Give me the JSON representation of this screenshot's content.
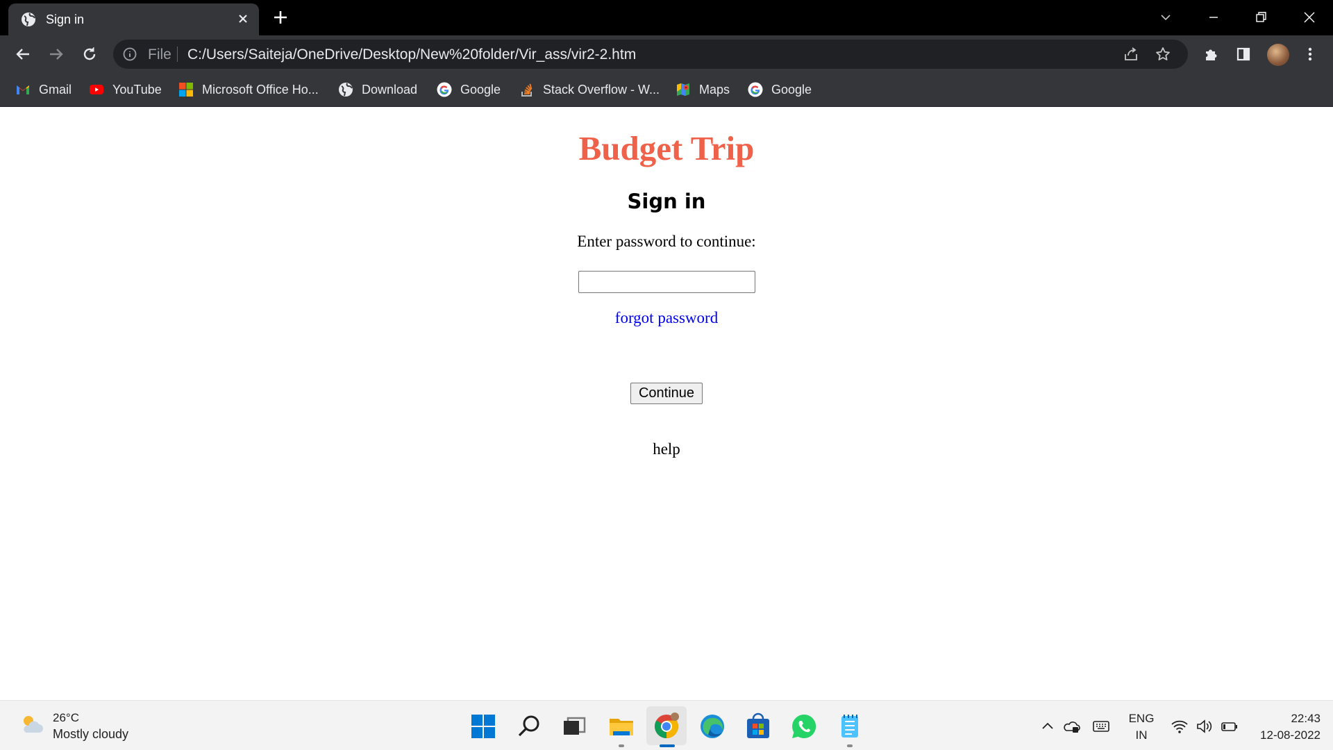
{
  "browser": {
    "tab": {
      "title": "Sign in"
    },
    "omnibox": {
      "scheme_label": "File",
      "url": "C:/Users/Saiteja/OneDrive/Desktop/New%20folder/Vir_ass/vir2-2.htm"
    },
    "bookmarks": [
      {
        "label": "Gmail",
        "icon": "gmail-icon"
      },
      {
        "label": "YouTube",
        "icon": "youtube-icon"
      },
      {
        "label": "Microsoft Office Ho...",
        "icon": "microsoft-icon"
      },
      {
        "label": "Download",
        "icon": "globe-icon"
      },
      {
        "label": "Google",
        "icon": "google-icon"
      },
      {
        "label": "Stack Overflow - W...",
        "icon": "stackoverflow-icon"
      },
      {
        "label": "Maps",
        "icon": "maps-icon"
      },
      {
        "label": "Google",
        "icon": "google-icon"
      }
    ]
  },
  "page": {
    "site_title": "Budget Trip",
    "heading": "Sign in",
    "prompt": "Enter password to continue:",
    "password_value": "",
    "forgot_link": "forgot password",
    "continue_button": "Continue",
    "help_text": "help",
    "title_color": "#f0614a",
    "link_color": "#0000ee"
  },
  "taskbar": {
    "weather": {
      "temp": "26°C",
      "desc": "Mostly cloudy",
      "icon": "partly-cloudy-icon"
    },
    "apps": [
      "start-icon",
      "search-icon",
      "task-view-icon",
      "file-explorer-icon",
      "chrome-icon",
      "edge-icon",
      "store-icon",
      "whatsapp-icon",
      "notepad-icon"
    ],
    "tray": {
      "language": "ENG",
      "region": "IN",
      "time": "22:43",
      "date": "12-08-2022"
    }
  }
}
